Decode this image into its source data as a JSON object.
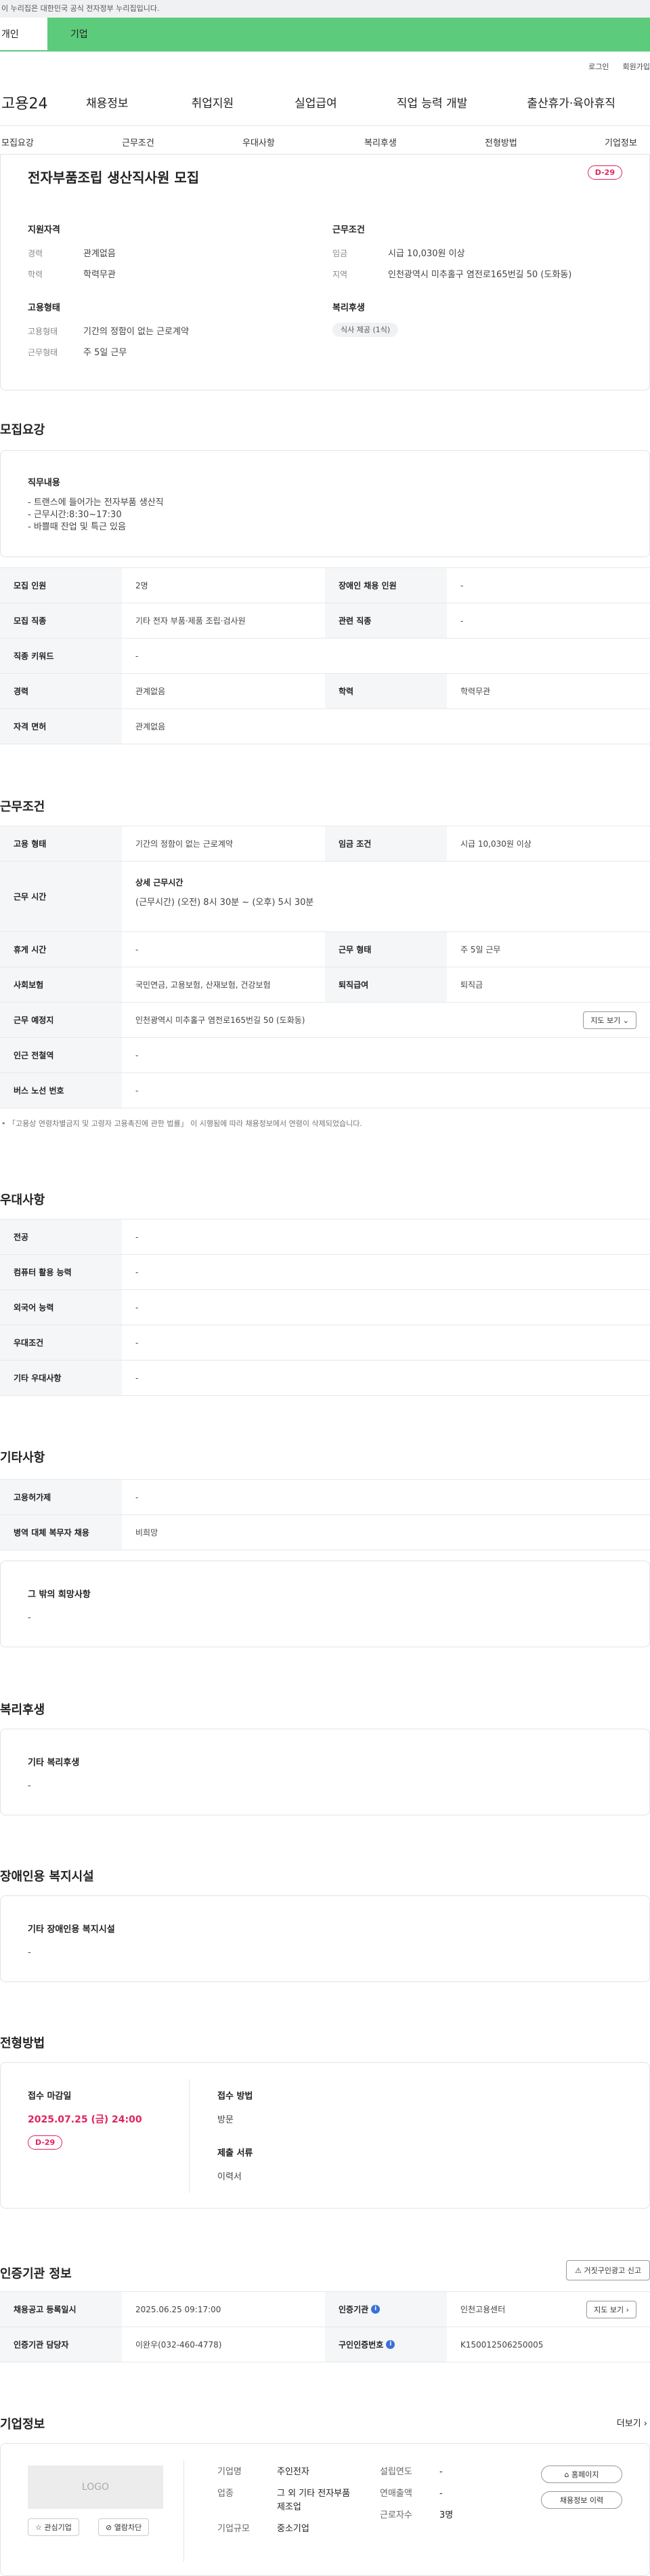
{
  "notice": "이 누리집은 대한민국 공식 전자정부 누리집입니다.",
  "top_tabs": [
    "개인",
    "기업"
  ],
  "util": [
    "로그인",
    "회원가입"
  ],
  "gnb": {
    "logo": "고용24",
    "items": [
      "채용정보",
      "취업지원",
      "실업급여",
      "직업 능력 개발",
      "출산휴가·육아휴직"
    ]
  },
  "subtabs": [
    "모집요강",
    "근무조건",
    "우대사항",
    "복리후생",
    "전형방법",
    "기업정보"
  ],
  "job": {
    "title": "전자부품조립 생산직사원 모집",
    "dday": "D-29"
  },
  "summary": {
    "qual_title": "지원자격",
    "career_label": "경력",
    "career": "관계없음",
    "edu_label": "학력",
    "edu": "학력무관",
    "emp_title": "고용형태",
    "emptype_label": "고용형태",
    "emptype": "기간의 정함이 없는 근로계약",
    "workform_label": "근무형태",
    "workform": "주 5일 근무",
    "cond_title": "근무조건",
    "wage_label": "임금",
    "wage": "시급 10,030원 이상",
    "area_label": "지역",
    "area": "인천광역시 미추홀구 염전로165번길 50 (도화동)",
    "welfare_title": "복리후생",
    "welfare_tag": "식사 제공 (1식)"
  },
  "recruit": {
    "title": "모집요강",
    "duty_title": "직무내용",
    "duties": [
      "- 트랜스에 들어가는 전자부품 생산직",
      "- 근무시간:8:30~17:30",
      "- 바쁠때 잔업 및 특근 있음"
    ],
    "rows": [
      {
        "k1": "모집 인원",
        "v1": "2명",
        "k2": "장애인 채용 인원",
        "v2": "-"
      },
      {
        "k1": "모집 직종",
        "v1": "기타 전자 부품·제품 조립·검사원",
        "k2": "관련 직종",
        "v2": "-"
      },
      {
        "k1": "직종 키워드",
        "v1": "-"
      },
      {
        "k1": "경력",
        "v1": "관계없음",
        "k2": "학력",
        "v2": "학력무관"
      },
      {
        "k1": "자격 면허",
        "v1": "관계없음"
      }
    ]
  },
  "work": {
    "title": "근무조건",
    "emptype_k": "고용 형태",
    "emptype_v": "기간의 정함이 없는 근로계약",
    "wage_k": "임금 조건",
    "wage_v": "시급 10,030원 이상",
    "time_k": "근무 시간",
    "time_t": "상세 근무시간",
    "time_v": "(근무시간) (오전) 8시 30분 ~ (오후) 5시 30분",
    "rest_k": "휴게 시간",
    "rest_v": "-",
    "form_k": "근무 형태",
    "form_v": "주 5일 근무",
    "ins_k": "사회보험",
    "ins_v": "국민연금, 고용보험, 산재보험, 건강보험",
    "retire_k": "퇴직급여",
    "retire_v": "퇴직금",
    "place_k": "근무 예정지",
    "place_v": "인천광역시 미추홀구 염전로165번길 50 (도화동)",
    "map_btn": "지도 보기",
    "station_k": "인근 전철역",
    "station_v": "-",
    "bus_k": "버스 노선 번호",
    "bus_v": "-",
    "footnote": "「고용상 연령차별금지 및 고령자 고용촉진에 관한 법률」 이 시행됨에 따라 채용정보에서 연령이 삭제되었습니다."
  },
  "pref": {
    "title": "우대사항",
    "rows": [
      [
        "전공",
        "-"
      ],
      [
        "컴퓨터 활용 능력",
        "-"
      ],
      [
        "외국어 능력",
        "-"
      ],
      [
        "우대조건",
        "-"
      ],
      [
        "기타 우대사항",
        "-"
      ]
    ]
  },
  "etc": {
    "title": "기타사항",
    "rows": [
      [
        "고용허가제",
        "-"
      ],
      [
        "병역 대체 복무자 채용",
        "비희망"
      ]
    ],
    "wish_title": "그 밖의 희망사항",
    "wish": "-"
  },
  "welfare": {
    "title": "복리후생",
    "box_title": "기타 복리후생",
    "box_val": "-"
  },
  "disabled": {
    "title": "장애인용 복지시설",
    "box_title": "기타 장애인용 복지시설",
    "box_val": "-"
  },
  "selection": {
    "title": "전형방법",
    "deadline_label": "접수 마감일",
    "deadline": "2025.07.25 (금) 24:00",
    "dday": "D-29",
    "method_label": "접수 방법",
    "method": "방문",
    "docs_label": "제출 서류",
    "docs": "이력서"
  },
  "cert": {
    "title": "인증기관 정보",
    "report_btn": "거짓구인광고 신고",
    "reg_k": "채용공고 등록일시",
    "reg_v": "2025.06.25 09:17:00",
    "org_k": "인증기관",
    "org_v": "인천고용센터",
    "map_btn": "지도 보기",
    "mgr_k": "인증기관 담당자",
    "mgr_v": "이완우(032-460-4778)",
    "num_k": "구인인증번호",
    "num_v": "K150012506250005"
  },
  "company": {
    "title": "기업정보",
    "more": "더보기",
    "logo": "LOGO",
    "fav": "관심기업",
    "block": "열람차단",
    "name_k": "기업명",
    "name_v": "주인전자",
    "ind_k": "업종",
    "ind_v": "그 외 기타 전자부품 제조업",
    "size_k": "기업규모",
    "size_v": "중소기업",
    "year_k": "설립연도",
    "year_v": "-",
    "sales_k": "연매출액",
    "sales_v": "-",
    "emp_k": "근로자수",
    "emp_v": "3명",
    "homepage": "홈페이지",
    "history": "채용정보 이력"
  }
}
